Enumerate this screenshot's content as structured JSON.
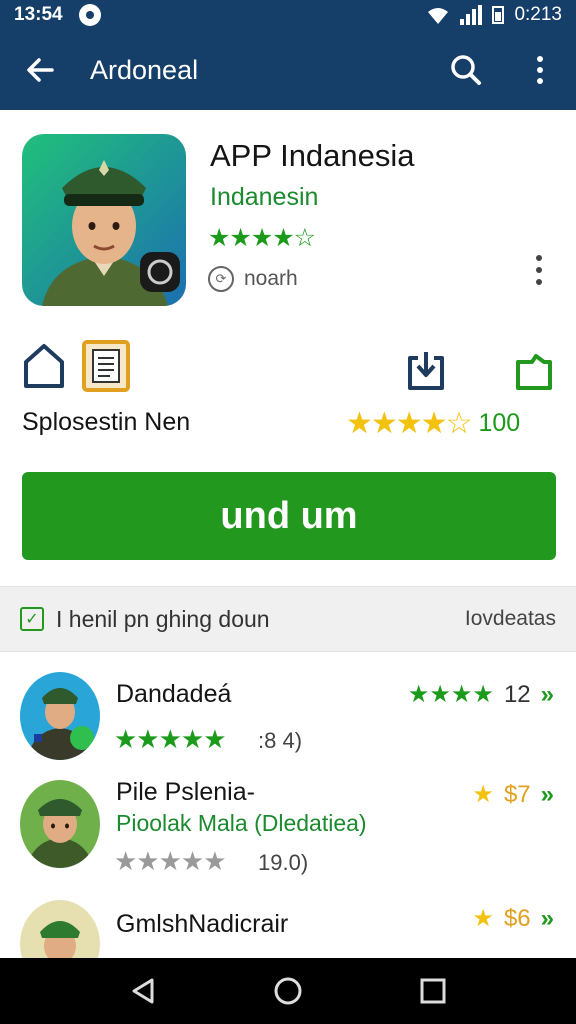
{
  "status_bar": {
    "time": "13:54",
    "right_text": "0:213"
  },
  "app_bar": {
    "title": "Ardoneal",
    "icons": [
      "back-arrow-icon",
      "search-icon",
      "more-vert-icon"
    ]
  },
  "app": {
    "name": "APP Indanesia",
    "developer": "Indanesin",
    "rating_stars": "★★★★☆",
    "rating_value": 3.5,
    "tag": "noarh"
  },
  "actions": {
    "label": "Splosestin Nen",
    "rating_stars": "★★★★☆",
    "rating_value": 4,
    "count": "100",
    "icons": [
      "bookmark-icon",
      "document-icon",
      "download-icon",
      "share-icon"
    ]
  },
  "install_button": {
    "label": "und um"
  },
  "filter": {
    "text": "I henil pn ghing doun",
    "right": "Iovdeatas"
  },
  "list": [
    {
      "title": "Dandadeá",
      "subtitle": "",
      "stars": "★★★★★",
      "count": ":8 4)",
      "right_stars": "★★★★",
      "right_value": "12"
    },
    {
      "title": "Pile Pslenia-",
      "subtitle": "Pioolak Mala (Dledatiea)",
      "stars": "★★★★★",
      "count": "19.0)",
      "right_stars": "★",
      "right_value": "$7"
    },
    {
      "title": "GmlshNadicrair",
      "subtitle": "",
      "stars": "",
      "count": "",
      "right_stars": "★",
      "right_value": "$6"
    }
  ],
  "colors": {
    "app_bar": "#153e68",
    "accent_green": "#22981f",
    "star_yellow": "#f2c20f",
    "star_grey": "#9a9a9a"
  },
  "nav": {
    "icons": [
      "back-triangle-icon",
      "home-circle-icon",
      "recents-square-icon"
    ]
  }
}
